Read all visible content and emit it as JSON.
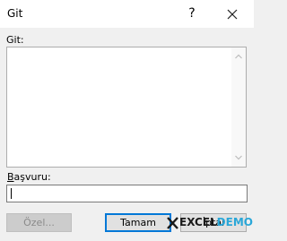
{
  "window": {
    "title": "Git"
  },
  "titlebar": {
    "help_glyph": "?"
  },
  "labels": {
    "git": "Git:",
    "ref_underline": "B",
    "ref_rest": "aşvuru:"
  },
  "buttons": {
    "ozel": "Özel...",
    "tamam": "Tamam",
    "iptal": "İptal"
  },
  "watermark": {
    "part1": "EXCEL",
    "part2": "DEMO"
  },
  "colors": {
    "accent": "#0078d7",
    "watermark_blue": "#2aa7d8"
  }
}
